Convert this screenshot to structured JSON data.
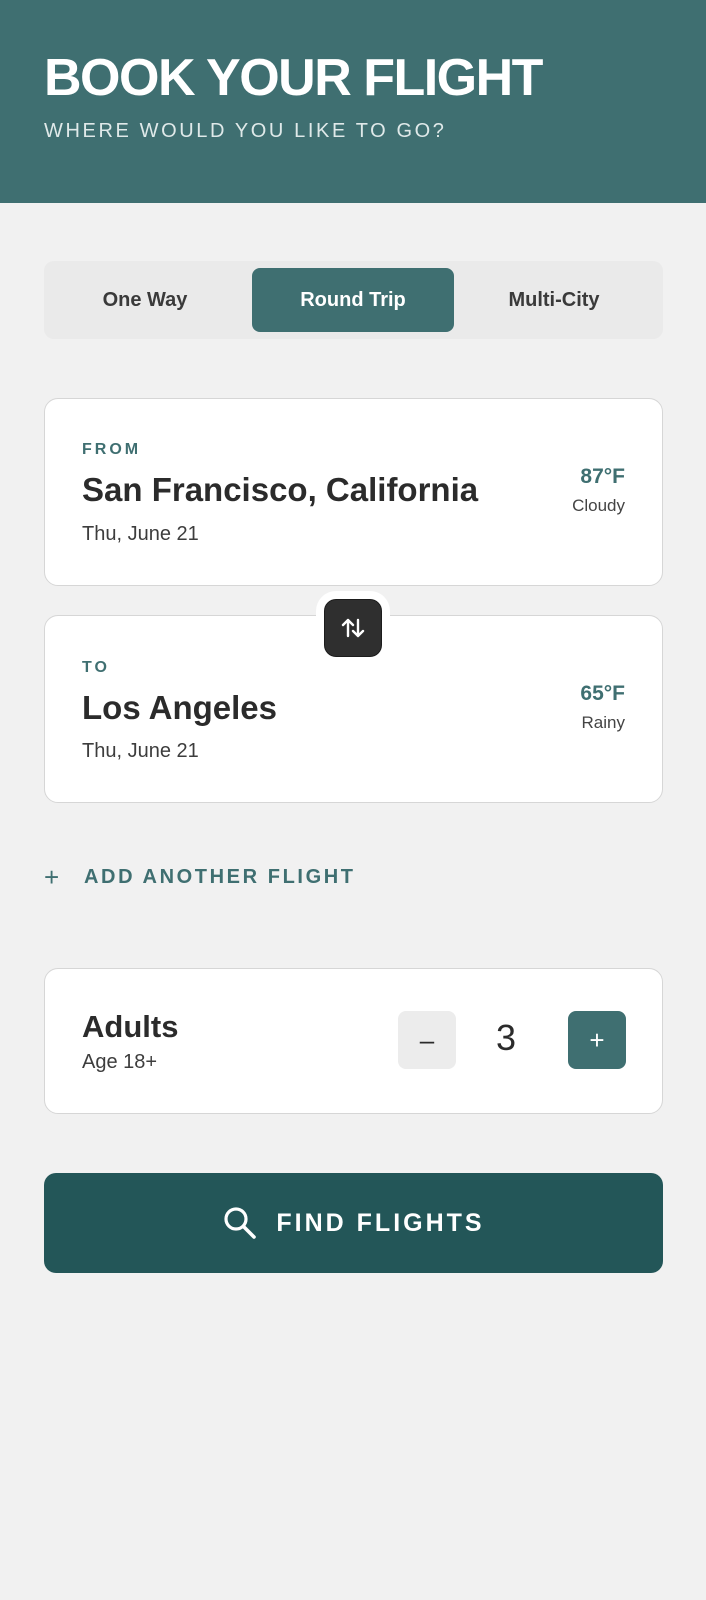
{
  "header": {
    "title": "BOOK YOUR FLIGHT",
    "subtitle": "WHERE WOULD YOU LIKE TO GO?"
  },
  "trip_types": {
    "selected": "Round Trip",
    "options": [
      "One Way",
      "Round Trip",
      "Multi-City"
    ]
  },
  "from": {
    "label": "FROM",
    "city": "San Francisco, California",
    "date": "Thu, June 21",
    "temperature": "87°F",
    "condition": "Cloudy"
  },
  "to": {
    "label": "TO",
    "city": "Los Angeles",
    "date": "Thu, June 21",
    "temperature": "65°F",
    "condition": "Rainy"
  },
  "swap": {
    "icon": "swap-vertical-icon"
  },
  "add_flight": {
    "icon_glyph": "+",
    "label": "ADD ANOTHER FLIGHT"
  },
  "passengers": {
    "title": "Adults",
    "subtitle": "Age 18+",
    "count": "3",
    "decrement_glyph": "–",
    "increment_glyph": "+"
  },
  "search": {
    "label": "FIND FLIGHTS",
    "icon": "search-icon"
  },
  "colors": {
    "brand": "#3f6f71",
    "button_dark": "#235658",
    "background": "#f1f1f1"
  }
}
